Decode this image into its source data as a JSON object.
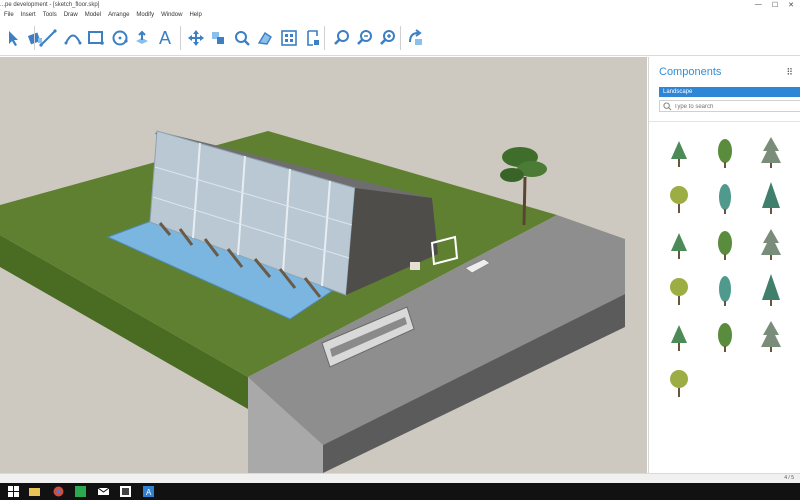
{
  "window": {
    "title": "...pe development - [sketch_floor.skp]",
    "controls": [
      "—",
      "☐",
      "✕"
    ]
  },
  "menu": [
    "File",
    "Insert",
    "Tools",
    "Draw",
    "Model",
    "Arrange",
    "Modify",
    "Window",
    "Help"
  ],
  "toolbar": {
    "text_tool_glyph": "A",
    "icons": [
      "select-icon",
      "paint-icon",
      "line-icon",
      "arc-icon",
      "rectangle-icon",
      "circle-icon",
      "pushpull-icon",
      "text-icon",
      "move-icon",
      "rotate-icon",
      "scale-icon",
      "offset-icon",
      "tape-icon",
      "section-icon",
      "dimension-icon",
      "zoom-icon",
      "zoom-window-icon",
      "zoom-extents-icon",
      "orbit-icon"
    ]
  },
  "components": {
    "title": "Components",
    "menu_glyph": "⠿",
    "collection": "Landscape",
    "search_placeholder": "Type to search",
    "tree_count": 16
  },
  "status": {
    "right_text": "4 / 5"
  },
  "taskbar": {
    "icons": [
      "windows-start-icon",
      "file-explorer-icon",
      "chrome-icon",
      "green-app-icon",
      "mail-icon",
      "store-icon",
      "sketch-app-icon"
    ]
  },
  "colors": {
    "accent": "#2e86d6",
    "viewport_bg": "#cdc9c0",
    "grass": "#5f8030",
    "water": "#7bb6e0",
    "road": "#8e8e8e"
  }
}
